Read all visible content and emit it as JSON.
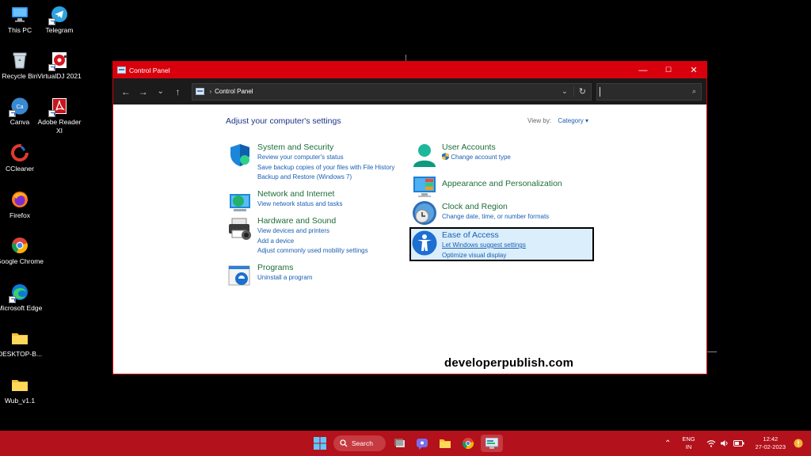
{
  "desktop": {
    "icons": [
      {
        "label": "This PC"
      },
      {
        "label": "Telegram"
      },
      {
        "label": "Recycle Bin"
      },
      {
        "label": "VirtualDJ 2021"
      },
      {
        "label": "Canva"
      },
      {
        "label": "Adobe Reader XI"
      },
      {
        "label": "CCleaner"
      },
      {
        "label": "Firefox"
      },
      {
        "label": "Google Chrome"
      },
      {
        "label": "Microsoft Edge"
      },
      {
        "label": "DESKTOP-B..."
      },
      {
        "label": "Wub_v1.1"
      }
    ]
  },
  "window": {
    "title": "Control Panel",
    "controls": {
      "minimize": "—",
      "maximize": "☐",
      "close": "✕"
    },
    "nav": {
      "back": "←",
      "forward": "→",
      "recent": "⌄",
      "up": "↑"
    },
    "address": {
      "path": "Control Panel",
      "separator": "›",
      "dropdown": "⌄",
      "refresh": "↻"
    },
    "search": {
      "icon": "search-icon",
      "glyph": "⌕"
    }
  },
  "content": {
    "heading": "Adjust your computer's settings",
    "view_by_label": "View by:",
    "view_by_value": "Category ▾",
    "categories": [
      {
        "title": "System and Security",
        "links": [
          "Review your computer's status",
          "Save backup copies of your files with File History",
          "Backup and Restore (Windows 7)"
        ]
      },
      {
        "title": "Network and Internet",
        "links": [
          "View network status and tasks"
        ]
      },
      {
        "title": "Hardware and Sound",
        "links": [
          "View devices and printers",
          "Add a device",
          "Adjust commonly used mobility settings"
        ]
      },
      {
        "title": "Programs",
        "links": [
          "Uninstall a program"
        ]
      },
      {
        "title": "User Accounts",
        "links": [
          "Change account type"
        ]
      },
      {
        "title": "Appearance and Personalization",
        "links": []
      },
      {
        "title": "Clock and Region",
        "links": [
          "Change date, time, or number formats"
        ]
      },
      {
        "title": "Ease of Access",
        "links": [
          "Let Windows suggest settings",
          "Optimize visual display"
        ]
      }
    ],
    "watermark": "developerpublish.com"
  },
  "taskbar": {
    "search_label": "Search",
    "tray": {
      "lang_1": "ENG",
      "lang_2": "IN",
      "time": "12:42",
      "date": "27-02-2023",
      "chevron": "⌃"
    }
  },
  "colors": {
    "titlebar": "#d9000d",
    "taskbar": "#b3111b",
    "category_title": "#1e6d3a",
    "link": "#1a5fb4",
    "heading": "#1e3287",
    "highlight": "#dbeefb"
  }
}
